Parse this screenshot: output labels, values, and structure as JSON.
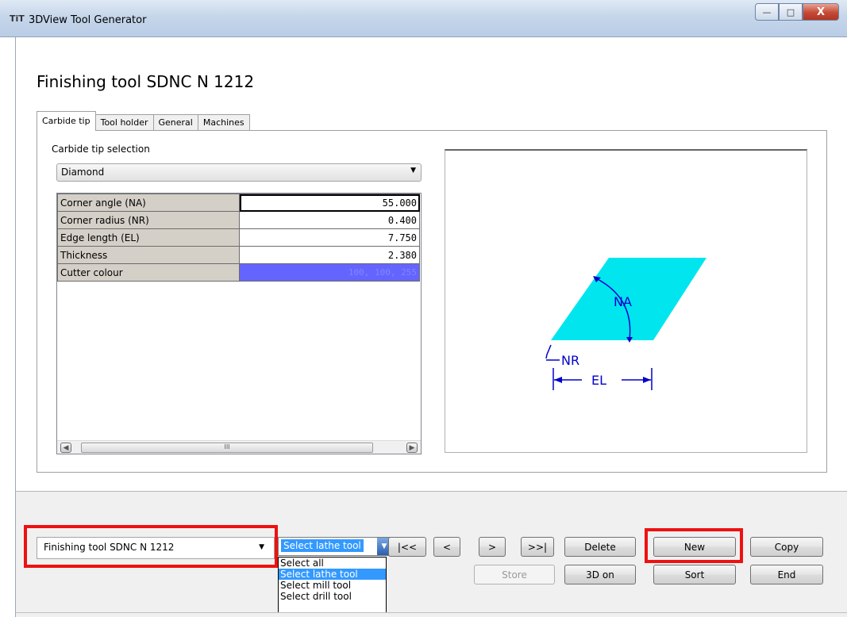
{
  "window": {
    "app_icon": "TiT",
    "title": "3DView Tool Generator",
    "buttons": {
      "minimize": "—",
      "maximize": "□",
      "close": "X"
    }
  },
  "heading": "Finishing tool SDNC N 1212",
  "tabs": [
    "Carbide tip",
    "Tool holder",
    "General",
    "Machines"
  ],
  "carbide": {
    "selection_label": "Carbide tip selection",
    "selected": "Diamond",
    "properties": [
      {
        "name": "Corner angle (NA)",
        "value": "55.000"
      },
      {
        "name": "Corner radius (NR)",
        "value": "0.400"
      },
      {
        "name": "Edge length (EL)",
        "value": "7.750"
      },
      {
        "name": "Thickness",
        "value": "2.380"
      },
      {
        "name": "Cutter colour",
        "value": "100, 100, 255"
      }
    ],
    "scroll_thumb_glyph": "III"
  },
  "diagram": {
    "labels": {
      "na": "NA",
      "nr": "NR",
      "el": "EL"
    },
    "colors": {
      "insert": "#00e5ee",
      "dimension": "#0000cc"
    }
  },
  "bottom": {
    "tool_selected": "Finishing tool SDNC N 1212",
    "filter_selected": "Select lathe tool",
    "filter_options": [
      "Select all",
      "Select lathe tool",
      "Select mill tool",
      "Select drill tool"
    ],
    "filter_highlighted_index": 1,
    "nav": {
      "first": "|<<",
      "prev": "<",
      "next": ">",
      "last": ">>|"
    },
    "actions": {
      "delete": "Delete",
      "new": "New",
      "copy": "Copy",
      "store": "Store",
      "view3d": "3D on",
      "sort": "Sort",
      "end": "End"
    }
  },
  "colors": {
    "highlight_box": "#ee1111",
    "cutter_colour": "#6464ff"
  }
}
